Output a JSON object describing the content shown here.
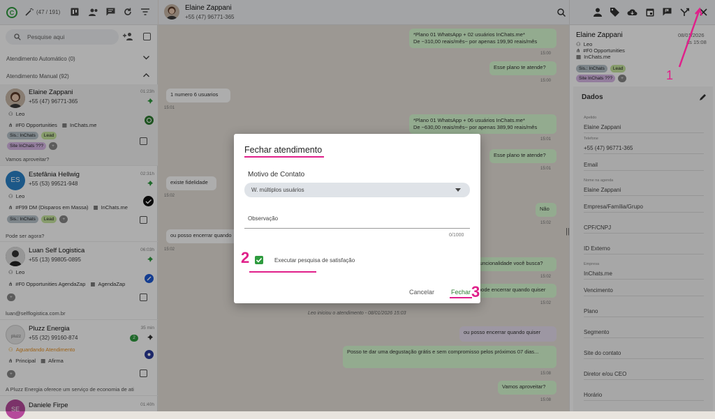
{
  "colors": {
    "accent": "#2e7d32",
    "annotation": "#e0208a",
    "bubble_out": "#d9fdd3"
  },
  "sidebar": {
    "counter": "(47 / 191)",
    "search_placeholder": "Pesquise aqui",
    "section_auto": "Atendimento Automático (0)",
    "section_manual": "Atendimento Manual (92)",
    "conversations": [
      {
        "name": "Elaine Zappani",
        "phone": "+55 (47) 96771-365",
        "time": "01:23h",
        "agent": "Leo",
        "pipeline": "#F0 Opportunities",
        "company": "InChats.me",
        "tags": [
          "Sis.: InChats",
          "Lead",
          "Site InChats ???",
          "+"
        ],
        "preview": "Vamos aproveitar?"
      },
      {
        "name": "Estefânia Hellwig",
        "initials": "ES",
        "phone": "+55 (53) 99521-948",
        "time": "02:31h",
        "agent": "Leo",
        "pipeline": "#F99 DM (Disparos em Massa)",
        "company": "InChats.me",
        "tags": [
          "Sis.: InChats",
          "Lead",
          "+"
        ],
        "preview": "Pode ser agora?"
      },
      {
        "name": "Luan Self Logistica",
        "phone": "+55 (13) 99805-0895",
        "time": "06:03h",
        "agent": "Leo",
        "pipeline": "#F0 Opportunities AgendaZap",
        "company": "AgendaZap",
        "tags": [
          "+"
        ],
        "preview": "luan@selflogistica.com.br"
      },
      {
        "name": "Pluzz Energia",
        "phone": "+55 (32) 99160-874",
        "time": "35 min",
        "badge": "2",
        "status": "Aguardando Atendimento",
        "pipeline": "Principal",
        "company": "Afirma",
        "tags": [
          "+"
        ],
        "preview": "A Pluzz Energia  oferece um serviço de economia de ati"
      },
      {
        "name": "Daniele Firpe",
        "initials": "SE",
        "time": "01:40h"
      }
    ]
  },
  "chat": {
    "contact_name": "Elaine Zappani",
    "contact_phone": "+55 (47) 96771-365",
    "messages": [
      {
        "text1": "*Plano 01 WhatsApp + 02 usuários InChats.me*",
        "text2": "De ~310,00 reais/mês~ por apenas 199,90 reais/mês",
        "time": "15:00"
      },
      {
        "text": "Esse plano te atende?",
        "time": "15:00"
      },
      {
        "text": "1 numero 6 usuarios",
        "time": "15:01"
      },
      {
        "text1": "*Plano 01 WhatsApp + 06 usuários InChats.me*",
        "text2": "De ~630,00 reais/mês~ por apenas 389,90 reais/mês",
        "time": "15:01"
      },
      {
        "text": "Esse plano te atende?",
        "time": "15:01"
      },
      {
        "text": "existe fidelidade",
        "time": "15:02"
      },
      {
        "text": "Não",
        "time": "15:02"
      },
      {
        "text": "ou posso encerrar quando",
        "time": "15:02"
      },
      {
        "text": "funcionalidade você busca?",
        "time": "15:02"
      },
      {
        "text": "pode encerrar quando quiser",
        "time": "15:02"
      },
      {
        "text": "ou posso encerrar quando quiser",
        "time": ""
      },
      {
        "text": "Posso te dar uma degustação grátis e sem compromisso pelos próximos 07 dias...",
        "time": "15:08"
      },
      {
        "text": "Vamos aproveitar?",
        "time": "15:08"
      }
    ],
    "system_msg": "Leo iniciou o atendimento - 08/01/2026 15:03"
  },
  "right_panel": {
    "name": "Elaine Zappani",
    "date": "08/01/2026",
    "time": "às 15:08",
    "agent": "Leo",
    "pipeline": "#F0 Opportunities",
    "company": "InChats.me",
    "tags": [
      "Sis.: InChats",
      "Lead",
      "Site InChats ???",
      "+"
    ],
    "section_title": "Dados",
    "fields": [
      {
        "label": "Apelido",
        "value": "Elaine Zappani"
      },
      {
        "label": "Telefone",
        "value": "+55 (47) 96771-365"
      },
      {
        "label": "",
        "value": "Email"
      },
      {
        "label": "Nome na agenda",
        "value": "Elaine Zappani"
      },
      {
        "label": "",
        "value": "Empresa/Família/Grupo"
      },
      {
        "label": "",
        "value": "CPF/CNPJ"
      },
      {
        "label": "",
        "value": "ID Externo"
      },
      {
        "label": "Empresa",
        "value": "InChats.me"
      },
      {
        "label": "",
        "value": "Vencimento"
      },
      {
        "label": "",
        "value": "Plano"
      },
      {
        "label": "",
        "value": "Segmento"
      },
      {
        "label": "",
        "value": "Site do contato"
      },
      {
        "label": "",
        "value": "Diretor e/ou CEO"
      },
      {
        "label": "",
        "value": "Horário"
      }
    ]
  },
  "modal": {
    "title": "Fechar atendimento",
    "motivo_label": "Motivo de Contato",
    "motivo_value": "W. múltiplos usuários",
    "obs_label": "Observação",
    "counter": "0/1000",
    "checkbox_label": "Executar pesquisa de satisfação",
    "checkbox_checked": true,
    "cancel": "Cancelar",
    "confirm": "Fechar"
  },
  "annotations": {
    "n1": "1",
    "n2": "2",
    "n3": "3"
  }
}
